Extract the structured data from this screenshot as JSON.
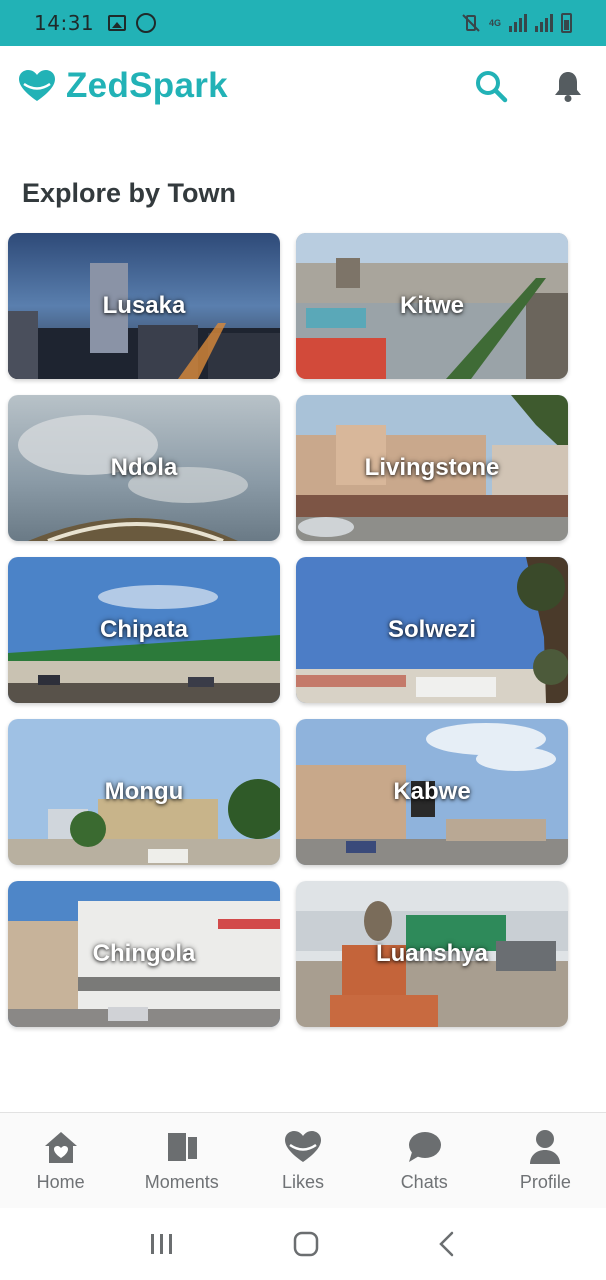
{
  "status_bar": {
    "time": "14:31",
    "network": "4G"
  },
  "header": {
    "app_title": "ZedSpark",
    "brand_color": "#22b2b6",
    "actions": [
      "search-icon",
      "bell-icon"
    ]
  },
  "section_title": "Explore by Town",
  "towns": [
    {
      "name": "Lusaka"
    },
    {
      "name": "Kitwe"
    },
    {
      "name": "Ndola"
    },
    {
      "name": "Livingstone"
    },
    {
      "name": "Chipata"
    },
    {
      "name": "Solwezi"
    },
    {
      "name": "Mongu"
    },
    {
      "name": "Kabwe"
    },
    {
      "name": "Chingola"
    },
    {
      "name": "Luanshya"
    }
  ],
  "bottom_nav": [
    {
      "label": "Home",
      "icon": "home-icon"
    },
    {
      "label": "Moments",
      "icon": "moments-icon"
    },
    {
      "label": "Likes",
      "icon": "heart-icon"
    },
    {
      "label": "Chats",
      "icon": "chat-icon"
    },
    {
      "label": "Profile",
      "icon": "profile-icon"
    }
  ]
}
